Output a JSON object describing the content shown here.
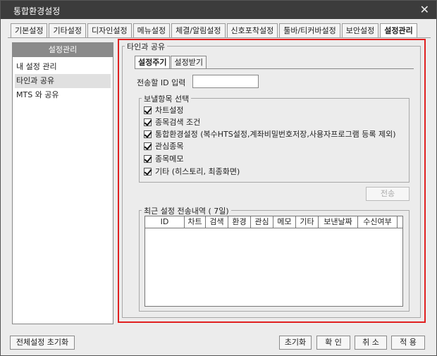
{
  "window": {
    "title": "통합환경설정"
  },
  "tabs": [
    {
      "label": "기본설정"
    },
    {
      "label": "기타설정"
    },
    {
      "label": "디자인설정"
    },
    {
      "label": "메뉴설정"
    },
    {
      "label": "체결/알림설정"
    },
    {
      "label": "신호포착설정"
    },
    {
      "label": "툴바/티커바설정"
    },
    {
      "label": "보안설정"
    },
    {
      "label": "설정관리",
      "active": true
    }
  ],
  "sidebar": {
    "header": "설정관리",
    "items": [
      {
        "label": "내 설정 관리"
      },
      {
        "label": "타인과 공유",
        "selected": true
      },
      {
        "label": "MTS 와 공유"
      }
    ]
  },
  "share_group": {
    "title": "타인과 공유"
  },
  "subtabs": [
    {
      "label": "설정주기",
      "active": true
    },
    {
      "label": "설정받기"
    }
  ],
  "id_field": {
    "label": "전송할 ID 입력",
    "value": ""
  },
  "items_group": {
    "title": "보낼항목 선택",
    "items": [
      {
        "label": "차트설정",
        "checked": true
      },
      {
        "label": "종목검색 조건",
        "checked": true
      },
      {
        "label": "통합환경설정 (복수HTS설정,계좌비밀번호저장,사용자프로그램 등록 제외)",
        "checked": true
      },
      {
        "label": "관심종목",
        "checked": true
      },
      {
        "label": "종목메모",
        "checked": true
      },
      {
        "label": "기타 (히스토리, 최종화면)",
        "checked": true
      }
    ]
  },
  "send_button": {
    "label": "전송",
    "disabled": true
  },
  "history_group": {
    "title": "최근 설정 전송내역 ( 7일)",
    "columns": [
      "ID",
      "차트",
      "검색",
      "환경",
      "관심",
      "메모",
      "기타",
      "보낸날짜",
      "수신여부"
    ],
    "rows": []
  },
  "footer": {
    "reset_all": "전체설정 초기화",
    "reset": "초기화",
    "ok": "확 인",
    "cancel": "취 소",
    "apply": "적 용"
  }
}
